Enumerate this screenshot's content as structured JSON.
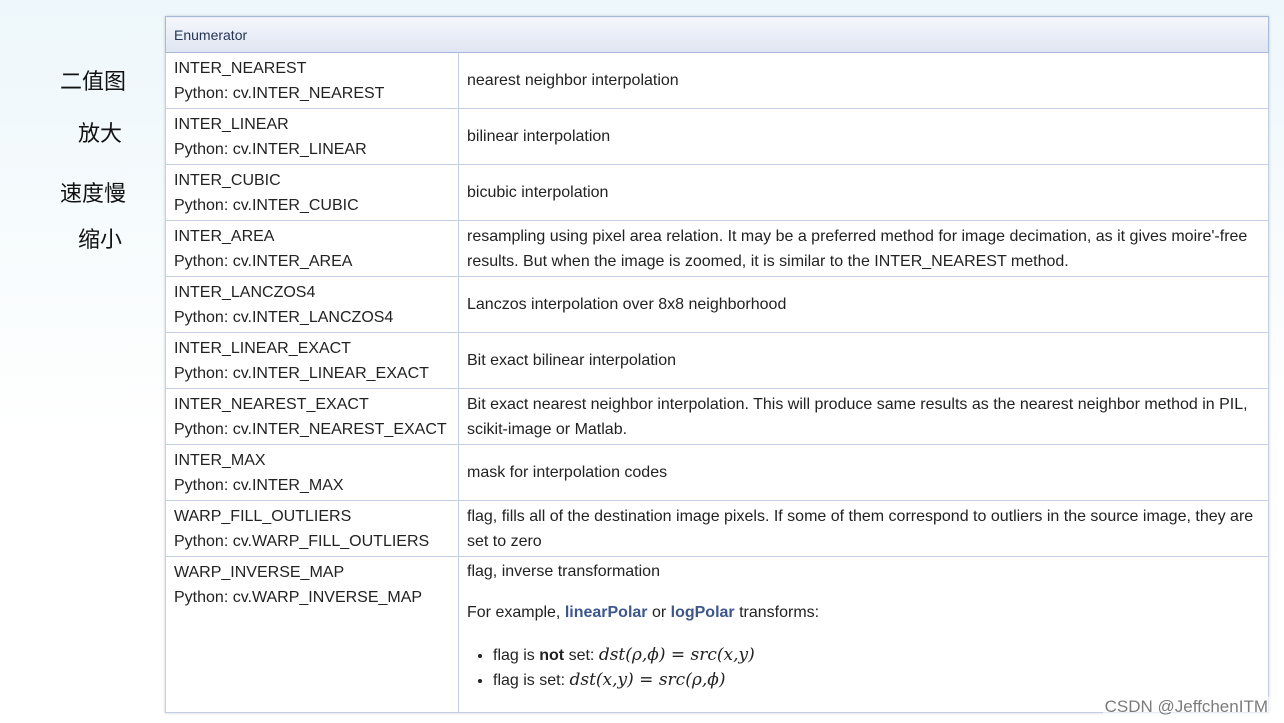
{
  "side_notes": [
    "二值图",
    "放大",
    "速度慢",
    "缩小"
  ],
  "table": {
    "header": "Enumerator",
    "rows": [
      {
        "name": "INTER_NEAREST",
        "python": "Python: cv.INTER_NEAREST",
        "desc": "nearest neighbor interpolation"
      },
      {
        "name": "INTER_LINEAR",
        "python": "Python: cv.INTER_LINEAR",
        "desc": "bilinear interpolation"
      },
      {
        "name": "INTER_CUBIC",
        "python": "Python: cv.INTER_CUBIC",
        "desc": "bicubic interpolation"
      },
      {
        "name": "INTER_AREA",
        "python": "Python: cv.INTER_AREA",
        "desc": "resampling using pixel area relation. It may be a preferred method for image decimation, as it gives moire'-free results. But when the image is zoomed, it is similar to the INTER_NEAREST method."
      },
      {
        "name": "INTER_LANCZOS4",
        "python": "Python: cv.INTER_LANCZOS4",
        "desc": "Lanczos interpolation over 8x8 neighborhood"
      },
      {
        "name": "INTER_LINEAR_EXACT",
        "python": "Python: cv.INTER_LINEAR_EXACT",
        "desc": "Bit exact bilinear interpolation"
      },
      {
        "name": "INTER_NEAREST_EXACT",
        "python": "Python: cv.INTER_NEAREST_EXACT",
        "desc": "Bit exact nearest neighbor interpolation. This will produce same results as the nearest neighbor method in PIL, scikit-image or Matlab."
      },
      {
        "name": "INTER_MAX",
        "python": "Python: cv.INTER_MAX",
        "desc": "mask for interpolation codes"
      },
      {
        "name": "WARP_FILL_OUTLIERS",
        "python": "Python: cv.WARP_FILL_OUTLIERS",
        "desc": "flag, fills all of the destination image pixels. If some of them correspond to outliers in the source image, they are set to zero"
      }
    ],
    "last_row": {
      "name": "WARP_INVERSE_MAP",
      "python": "Python: cv.WARP_INVERSE_MAP",
      "desc": "flag, inverse transformation",
      "example_prefix": "For example, ",
      "link1": "linearPolar",
      "example_or": " or ",
      "link2": "logPolar",
      "example_suffix": " transforms:",
      "bullet1_prefix": "flag is ",
      "bullet1_strong": "not",
      "bullet1_suffix": " set: ",
      "bullet1_math": "dst(ρ,ϕ) = src(x,y)",
      "bullet2_prefix": "flag is set: ",
      "bullet2_math": "dst(x,y) = src(ρ,ϕ)"
    }
  },
  "watermark": "CSDN @JeffchenITM"
}
